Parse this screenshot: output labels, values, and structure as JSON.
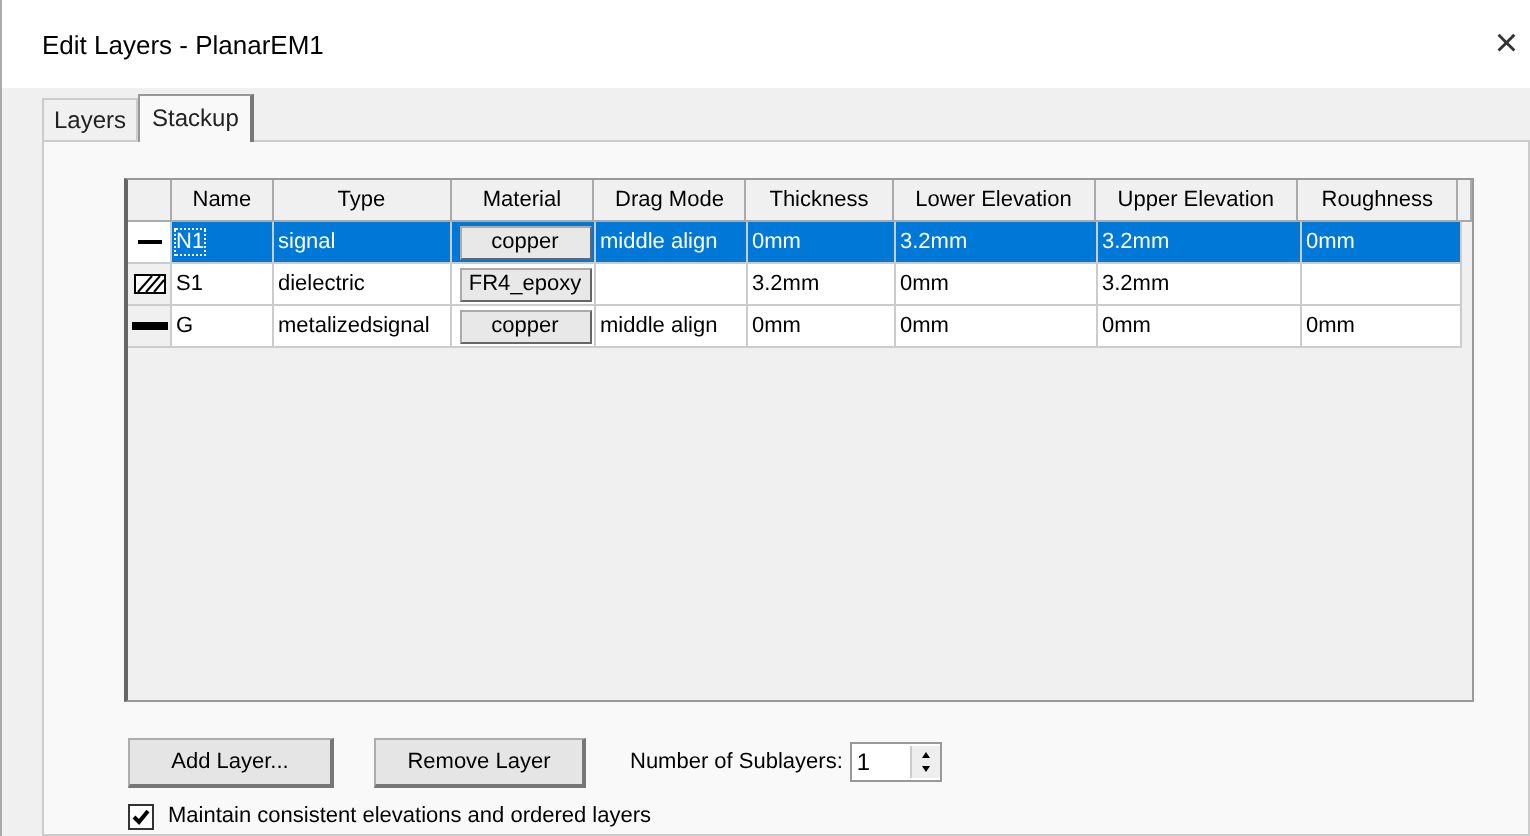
{
  "window": {
    "title": "Edit Layers - PlanarEM1",
    "close": "×"
  },
  "tabs": [
    {
      "label": "Layers",
      "selected": false
    },
    {
      "label": "Stackup",
      "selected": true
    }
  ],
  "table": {
    "columns": [
      "Name",
      "Type",
      "Material",
      "Drag Mode",
      "Thickness",
      "Lower Elevation",
      "Upper Elevation",
      "Roughness"
    ],
    "rows": [
      {
        "kind": "thin",
        "selected": true,
        "name": "N1",
        "type": "signal",
        "material": "copper",
        "drag_mode": "middle align",
        "thickness": "0mm",
        "lower_elevation": "3.2mm",
        "upper_elevation": "3.2mm",
        "roughness": "0mm"
      },
      {
        "kind": "hatched",
        "selected": false,
        "name": "S1",
        "type": "dielectric",
        "material": "FR4_epoxy",
        "drag_mode": "",
        "thickness": "3.2mm",
        "lower_elevation": "0mm",
        "upper_elevation": "3.2mm",
        "roughness": ""
      },
      {
        "kind": "thick",
        "selected": false,
        "name": "G",
        "type": "metalizedsignal",
        "material": "copper",
        "drag_mode": "middle align",
        "thickness": "0mm",
        "lower_elevation": "0mm",
        "upper_elevation": "0mm",
        "roughness": "0mm"
      }
    ]
  },
  "buttons": [
    "Add Layer...",
    "Remove Layer"
  ],
  "sublayers": {
    "label": "Number of Sublayers:",
    "value": "1"
  },
  "maintain": {
    "label": "Maintain consistent elevations and ordered layers",
    "checked": true
  }
}
